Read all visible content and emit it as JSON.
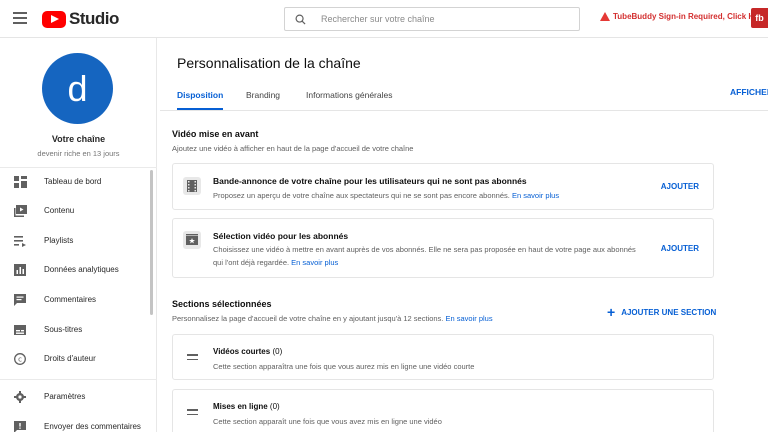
{
  "topbar": {
    "logo_text": "Studio",
    "search_placeholder": "Rechercher sur votre chaîne",
    "tubebuddy_warning": "TubeBuddy Sign-in Required, Click Here",
    "fb_label": "fb"
  },
  "sidebar": {
    "avatar_letter": "d",
    "channel_name": "Votre chaîne",
    "channel_sub": "devenir riche en 13 jours",
    "items": [
      {
        "label": "Tableau de bord",
        "icon": "dashboard-icon"
      },
      {
        "label": "Contenu",
        "icon": "content-icon"
      },
      {
        "label": "Playlists",
        "icon": "playlists-icon"
      },
      {
        "label": "Données analytiques",
        "icon": "analytics-icon"
      },
      {
        "label": "Commentaires",
        "icon": "comments-icon"
      },
      {
        "label": "Sous-titres",
        "icon": "subtitles-icon"
      },
      {
        "label": "Droits d'auteur",
        "icon": "copyright-icon"
      }
    ],
    "bottom_items": [
      {
        "label": "Paramètres",
        "icon": "gear-icon"
      },
      {
        "label": "Envoyer des commentaires",
        "icon": "feedback-icon"
      }
    ]
  },
  "main": {
    "page_title": "Personnalisation de la chaîne",
    "tabs": [
      {
        "label": "Disposition",
        "active": true
      },
      {
        "label": "Branding",
        "active": false
      },
      {
        "label": "Informations générales",
        "active": false
      }
    ],
    "afficher_label": "AFFICHER",
    "featured": {
      "title": "Vidéo mise en avant",
      "desc": "Ajoutez une vidéo à afficher en haut de la page d'accueil de votre chaîne",
      "cards": [
        {
          "title": "Bande-annonce de votre chaîne pour les utilisateurs qui ne sont pas abonnés",
          "desc": "Proposez un aperçu de votre chaîne aux spectateurs qui ne se sont pas encore abonnés.",
          "link": "En savoir plus",
          "button": "AJOUTER"
        },
        {
          "title": "Sélection vidéo pour les abonnés",
          "desc_line1": "Choisissez une vidéo à mettre en avant auprès de vos abonnés. Elle ne sera pas proposée en haut de votre page aux abonnés",
          "desc_line2": "qui l'ont déjà regardée.",
          "link": "En savoir plus",
          "button": "AJOUTER"
        }
      ]
    },
    "sections": {
      "title": "Sections sélectionnées",
      "desc": "Personnalisez la page d'accueil de votre chaîne en y ajoutant jusqu'à 12 sections.",
      "link": "En savoir plus",
      "add_button": "AJOUTER UNE SECTION",
      "items": [
        {
          "title": "Vidéos courtes",
          "count": "(0)",
          "desc": "Cette section apparaîtra une fois que vous aurez mis en ligne une vidéo courte"
        },
        {
          "title": "Mises en ligne",
          "count": "(0)",
          "desc": "Cette section apparaît une fois que vous avez mis en ligne une vidéo"
        }
      ]
    }
  },
  "colors": {
    "accent": "#065fd4",
    "avatar": "#1565c0",
    "yt_red": "#ff0000",
    "warning": "#d32f2f"
  }
}
